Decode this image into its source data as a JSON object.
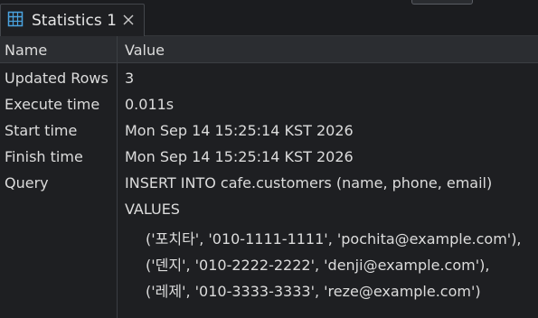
{
  "tab": {
    "title": "Statistics 1",
    "icon": "table-grid-icon",
    "close_icon": "close-icon"
  },
  "table": {
    "columns": [
      "Name",
      "Value"
    ],
    "rows": [
      {
        "name": "Updated Rows",
        "value": "3"
      },
      {
        "name": "Execute time",
        "value": "0.011s"
      },
      {
        "name": "Start time",
        "value": "Mon Sep 14 15:25:14 KST 2026"
      },
      {
        "name": "Finish time",
        "value": "Mon Sep 14 15:25:14 KST 2026"
      }
    ],
    "query": {
      "name": "Query",
      "lines": [
        "INSERT INTO cafe.customers (name, phone, email)",
        "VALUES",
        "('포치타', '010-1111-1111', 'pochita@example.com'),",
        "('덴지', '010-2222-2222', 'denji@example.com'),",
        "('레제', '010-3333-3333', 'reze@example.com')"
      ]
    }
  },
  "colors": {
    "background": "#1e1f22",
    "header": "#2b2d31",
    "text": "#dcdcdc",
    "icon_accent": "#4aa3df"
  }
}
